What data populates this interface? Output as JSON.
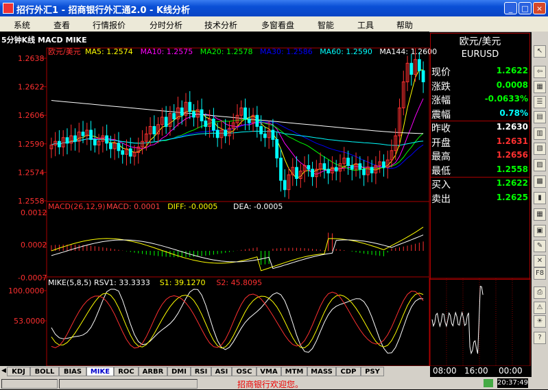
{
  "window": {
    "title": "招行外汇1 - 招商银行外汇通2.0 - K线分析",
    "min": "_",
    "max": "□",
    "close": "×"
  },
  "menu": [
    "系统",
    "查看",
    "行情报价",
    "分时分析",
    "技术分析",
    "多窗看盘",
    "智能",
    "工具",
    "帮助"
  ],
  "chart_header": {
    "period": "5分钟",
    "subtitle": "K线 MACD MIKE"
  },
  "price_panel": {
    "symbol_cn": "欧元/美元",
    "ma_labels": [
      {
        "text": "MA5: 1.2574",
        "color": "#ffff00"
      },
      {
        "text": "MA10: 1.2575",
        "color": "#ff00ff"
      },
      {
        "text": "MA20: 1.2578",
        "color": "#00ff00"
      },
      {
        "text": "MA30: 1.2586",
        "color": "#0000ff"
      },
      {
        "text": "MA60: 1.2590",
        "color": "#00ffff"
      },
      {
        "text": "MA144: 1.2600",
        "color": "#ffffff"
      }
    ],
    "y_ticks": [
      "1.2638",
      "1.2622",
      "1.2606",
      "1.2590",
      "1.2574",
      "1.2558"
    ]
  },
  "macd_panel": {
    "label": "MACD(26,12,9)",
    "values": [
      {
        "text": "MACD: 0.0001",
        "color": "#ff4040"
      },
      {
        "text": "DIFF: -0.0005",
        "color": "#ffff00"
      },
      {
        "text": "DEA: -0.0005",
        "color": "#ffffff"
      }
    ],
    "y_ticks": [
      "0.0012",
      "0.0002",
      "-0.0007"
    ]
  },
  "mike_panel": {
    "label": "MIKE(5,8,5)",
    "values": [
      {
        "text": "RSV1: 33.3333",
        "color": "#ffffff"
      },
      {
        "text": "S1: 39.1270",
        "color": "#ffff00"
      },
      {
        "text": "S2: 45.8095",
        "color": "#ff3030"
      }
    ],
    "y_ticks": [
      "100.0000",
      "53.0000"
    ]
  },
  "quote": {
    "name_cn": "欧元/美元",
    "name_en": "EURUSD",
    "rows": [
      {
        "label": "现价",
        "value": "1.2622",
        "color": "#00ff00"
      },
      {
        "label": "涨跌",
        "value": "0.0008",
        "color": "#00ff00"
      },
      {
        "label": "涨幅",
        "value": "-0.0633%",
        "color": "#00ff00"
      },
      {
        "label": "震幅",
        "value": "0.78%",
        "color": "#00ffff"
      },
      {
        "label": "昨收",
        "value": "1.2630",
        "color": "#ffffff"
      },
      {
        "label": "开盘",
        "value": "1.2631",
        "color": "#ff3030"
      },
      {
        "label": "最高",
        "value": "1.2656",
        "color": "#ff3030"
      },
      {
        "label": "最低",
        "value": "1.2558",
        "color": "#00ff00"
      },
      {
        "label": "买入",
        "value": "1.2622",
        "color": "#00ff00"
      },
      {
        "label": "卖出",
        "value": "1.2625",
        "color": "#00ff00"
      }
    ]
  },
  "tabs": [
    "KDJ",
    "BOLL",
    "BIAS",
    "MIKE",
    "ROC",
    "ARBR",
    "DMI",
    "RSI",
    "ASI",
    "OSC",
    "VMA",
    "MTM",
    "MASS",
    "CDP",
    "PSY"
  ],
  "active_tab": "MIKE",
  "time_axis": [
    "08:00",
    "16:00",
    "00:00"
  ],
  "status": {
    "message": "招商银行欢迎您。",
    "time": "20:37:49"
  },
  "chart_data": {
    "type": "candlestick",
    "price_range": [
      1.2558,
      1.2638
    ],
    "closes": [
      1.2588,
      1.259,
      1.2587,
      1.2592,
      1.2589,
      1.2593,
      1.259,
      1.2595,
      1.2593,
      1.2596,
      1.2591,
      1.2588,
      1.259,
      1.2593,
      1.2589,
      1.2586,
      1.2589,
      1.2585,
      1.2583,
      1.2586,
      1.2582,
      1.2584,
      1.2587,
      1.259,
      1.2594,
      1.2598,
      1.2594,
      1.2599,
      1.2603,
      1.2598,
      1.2605,
      1.2602,
      1.2608,
      1.2604,
      1.2611,
      1.2606,
      1.2603,
      1.2607,
      1.2601,
      1.2598,
      1.2602,
      1.2596,
      1.2592,
      1.2596,
      1.2593,
      1.2597,
      1.26,
      1.2604,
      1.2608,
      1.2602,
      1.26,
      1.2604,
      1.2598,
      1.2594,
      1.2592,
      1.2596,
      1.2591,
      1.2581,
      1.2569,
      1.2564,
      1.2572,
      1.2576,
      1.257,
      1.2574,
      1.2577,
      1.2575,
      1.2571,
      1.2575,
      1.2578,
      1.2575,
      1.2573,
      1.2576,
      1.2574,
      1.2578,
      1.2581,
      1.2577,
      1.2575,
      1.2578,
      1.2575,
      1.2572,
      1.2576,
      1.2573,
      1.2577,
      1.2579,
      1.2576,
      1.258,
      1.2585,
      1.2593,
      1.2608,
      1.2622,
      1.2632,
      1.2626,
      1.2634,
      1.2628,
      1.2622
    ]
  }
}
